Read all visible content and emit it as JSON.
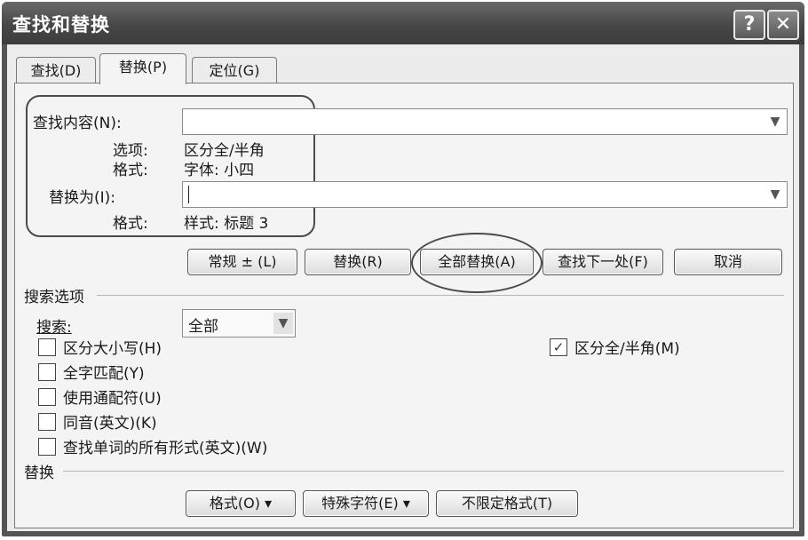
{
  "window": {
    "title": "查找和替换",
    "help_glyph": "?",
    "close_glyph": "✕"
  },
  "tabs": [
    {
      "label": "查找(D)",
      "active": false
    },
    {
      "label": "替换(P)",
      "active": true
    },
    {
      "label": "定位(G)",
      "active": false
    }
  ],
  "find": {
    "label": "查找内容(N):",
    "value": "",
    "options_key": "选项:",
    "options_value": "区分全/半角",
    "format_key": "格式:",
    "format_value": "字体: 小四"
  },
  "replace": {
    "label": "替换为(I):",
    "value": "",
    "format_key": "格式:",
    "format_value": "样式: 标题 3"
  },
  "buttons": {
    "less": "常规 ± (L)",
    "replace": "替换(R)",
    "replace_all": "全部替换(A)",
    "find_next": "查找下一处(F)",
    "cancel": "取消"
  },
  "search_options": {
    "header": "搜索选项",
    "search_label": "搜索:",
    "search_value": "全部",
    "checkboxes": [
      {
        "label": "区分大小写(H)",
        "checked": false
      },
      {
        "label": "全字匹配(Y)",
        "checked": false
      },
      {
        "label": "使用通配符(U)",
        "checked": false
      },
      {
        "label": "同音(英文)(K)",
        "checked": false
      },
      {
        "label": "查找单词的所有形式(英文)(W)",
        "checked": false
      }
    ],
    "width_checkbox": {
      "label": "区分全/半角(M)",
      "checked": true
    }
  },
  "replace_section": {
    "header": "替换",
    "format_button": "格式(O) ▾",
    "special_button": "特殊字符(E) ▾",
    "no_format_button": "不限定格式(T)"
  },
  "icons": {
    "dropdown": "chevron-down-icon",
    "check": "checkmark-icon"
  }
}
